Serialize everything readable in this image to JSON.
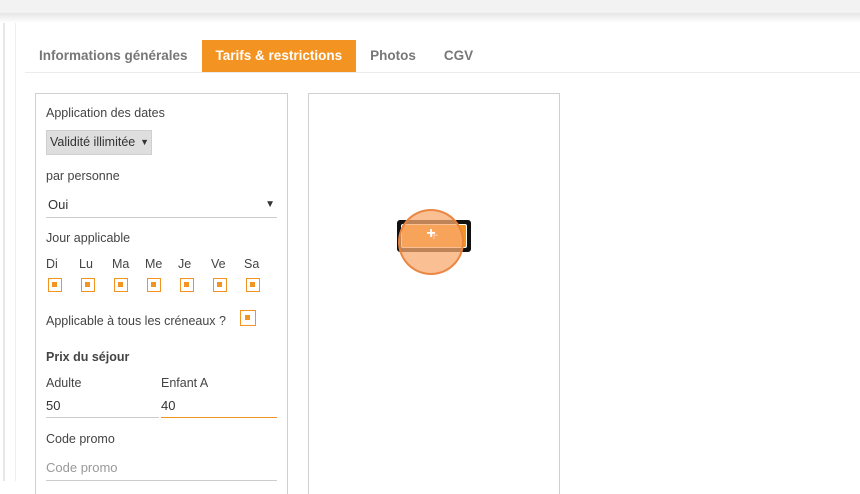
{
  "tabs": [
    {
      "label": "Informations générales",
      "active": false
    },
    {
      "label": "Tarifs & restrictions",
      "active": true
    },
    {
      "label": "Photos",
      "active": false
    },
    {
      "label": "CGV",
      "active": false
    }
  ],
  "form": {
    "date_application_label": "Application des dates",
    "date_application_value": "Validité illimitée",
    "per_person_label": "par personne",
    "per_person_value": "Oui",
    "days_label": "Jour applicable",
    "days": [
      {
        "label": "Di",
        "checked": true
      },
      {
        "label": "Lu",
        "checked": true
      },
      {
        "label": "Ma",
        "checked": true
      },
      {
        "label": "Me",
        "checked": true
      },
      {
        "label": "Je",
        "checked": true
      },
      {
        "label": "Ve",
        "checked": true
      },
      {
        "label": "Sa",
        "checked": true
      }
    ],
    "all_slots_label": "Applicable à tous les créneaux ?",
    "all_slots_checked": true,
    "price_section_title": "Prix du séjour",
    "adult_label": "Adulte",
    "adult_value": "50",
    "child_label": "Enfant A",
    "child_value": "40",
    "promo_label": "Code promo",
    "promo_placeholder": "Code promo"
  },
  "right_panel": {
    "add_label": "+"
  },
  "colors": {
    "accent": "#f39321",
    "tab_inactive": "#777777",
    "border": "#d0d0d0"
  }
}
